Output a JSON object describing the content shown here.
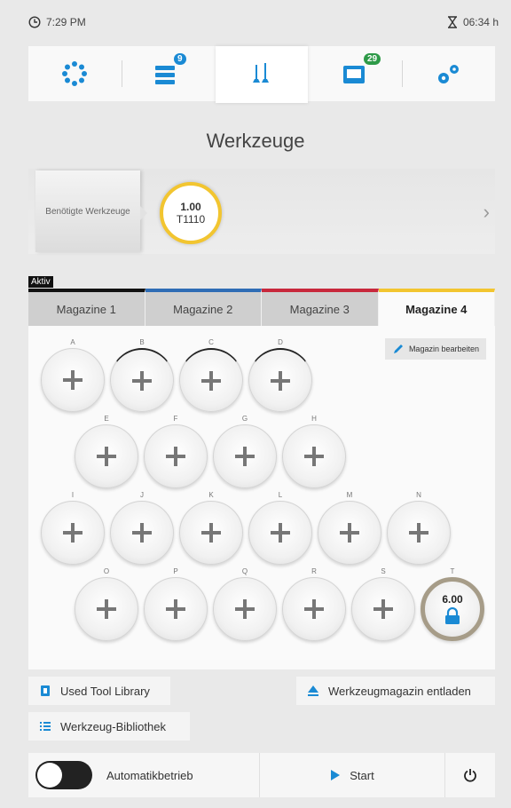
{
  "status": {
    "time": "7:29 PM",
    "timer": "06:34 h"
  },
  "nav": {
    "tabs": [
      {
        "icon": "dots-ring-icon"
      },
      {
        "icon": "job-list-icon",
        "badge": "9"
      },
      {
        "icon": "tools-icon",
        "active": true
      },
      {
        "icon": "machine-icon",
        "badge": "29"
      },
      {
        "icon": "settings-icon"
      }
    ]
  },
  "page": {
    "title": "Werkzeuge"
  },
  "required": {
    "label": "Benötigte Werkzeuge",
    "tool": {
      "value": "1.00",
      "id": "T1110"
    }
  },
  "aktiv": "Aktiv",
  "magazines": [
    {
      "label": "Magazine 1",
      "color": "#111111"
    },
    {
      "label": "Magazine 2",
      "color": "#2f6db5"
    },
    {
      "label": "Magazine 3",
      "color": "#c8283c"
    },
    {
      "label": "Magazine 4",
      "color": "#f2c530",
      "selected": true
    }
  ],
  "edit_button": "Magazin bearbeiten",
  "slots": {
    "A": "",
    "B": "",
    "C": "",
    "D": "",
    "E": "",
    "F": "",
    "G": "",
    "H": "",
    "I": "",
    "J": "",
    "K": "",
    "L": "",
    "M": "",
    "N": "",
    "O": "",
    "P": "",
    "Q": "",
    "R": "",
    "S": "",
    "T": "6.00"
  },
  "buttons": {
    "used_library": "Used Tool Library",
    "tool_library": "Werkzeug-Bibliothek",
    "unload": "Werkzeugmagazin entladen"
  },
  "bottom": {
    "auto": "Automatikbetrieb",
    "start": "Start"
  },
  "colors": {
    "accent_blue": "#1a8ad4",
    "badge_blue": "#1a8ad4",
    "badge_green": "#2e9a48",
    "active_yellow": "#f2c530"
  }
}
